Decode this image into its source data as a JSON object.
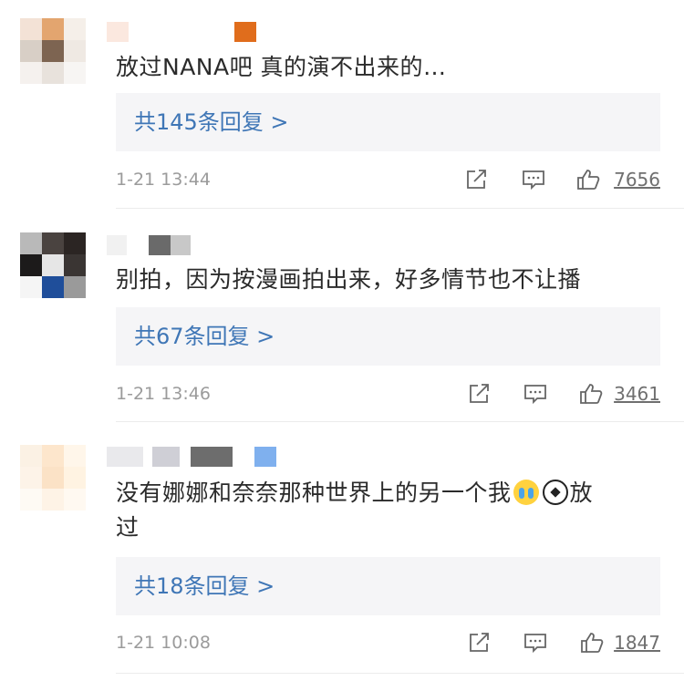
{
  "comments": [
    {
      "text": "放过NANA吧 真的演不出来的…",
      "replies_label": "共145条回复 >",
      "time": "1-21 13:44",
      "likes": "7656",
      "avatar_colors": [
        "#f3e2d6",
        "#e3a56f",
        "#f5efe9",
        "#d8cfc6",
        "#7d6451",
        "#efe9e3",
        "#f5f1ee",
        "#e8e2dc",
        "#f7f5f3"
      ],
      "name_blocks": [
        {
          "color": "#fbe8df"
        },
        {
          "color": "#e06d1c"
        }
      ]
    },
    {
      "text": "别拍，因为按漫画拍出来，好多情节也不让播",
      "replies_label": "共67条回复 >",
      "time": "1-21 13:46",
      "likes": "3461",
      "avatar_colors": [
        "#b9b9b9",
        "#4a4340",
        "#2b2523",
        "#1c1a1a",
        "#e6e6e6",
        "#3a3533",
        "#f5f5f5",
        "#1f4e9a",
        "#9a9a9a"
      ],
      "name_blocks": [
        {
          "color": "#f1f1f1"
        },
        {
          "color": "#6a6a6a"
        },
        {
          "color": "#c8c8c8"
        }
      ]
    },
    {
      "text_parts": [
        "没有娜娜和奈奈那种世界上的另一个我",
        "放",
        "过"
      ],
      "replies_label": "共18条回复 >",
      "time": "1-21 10:08",
      "likes": "1847",
      "avatar_colors": [
        "#fbf1e4",
        "#fde6cc",
        "#fff6ea",
        "#fdf3e8",
        "#fbe2c6",
        "#fff3e2",
        "#fefaf4",
        "#fef3e6",
        "#fff9f1"
      ],
      "name_blocks": [
        {
          "color": "#e9e9ec"
        },
        {
          "color": "#cfcfd6"
        },
        {
          "color": "#6d6d6d"
        },
        {
          "color": "#7fb0ee"
        }
      ]
    }
  ],
  "icons": {
    "share": "share-icon",
    "comment": "comment-icon",
    "like": "thumbs-up-icon",
    "emoji_1": "crying-face-emoji",
    "emoji_2": "soccer-ball-emoji"
  },
  "colors": {
    "reply_link": "#3f76b6",
    "reply_bg": "#f5f5f7",
    "meta_text": "#9b9b9b"
  }
}
